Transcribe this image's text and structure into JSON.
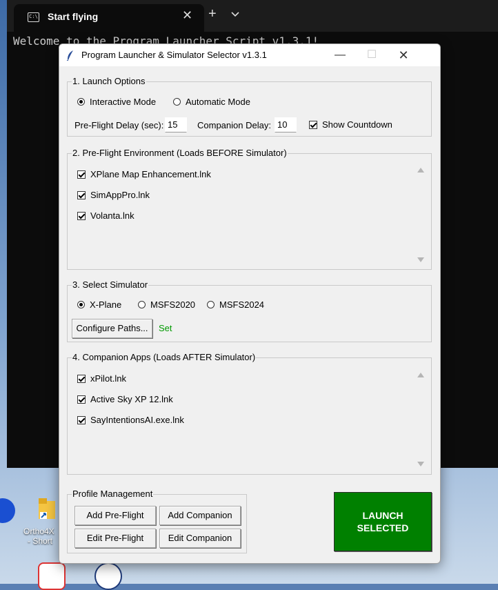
{
  "terminal": {
    "tab_title": "Start flying",
    "tab_close": "✕",
    "new_tab": "+",
    "dropdown": "⌄",
    "console_line": "Welcome to the Program Launcher Script v1.3.1!"
  },
  "desktop": {
    "icon_label_line1": "Ortho4X",
    "icon_label_line2": "- Short"
  },
  "dialog": {
    "title": "Program Launcher & Simulator Selector v1.3.1",
    "minimize": "—",
    "maximize": "☐",
    "close": "✕"
  },
  "launch_options": {
    "label": "1. Launch Options",
    "mode_interactive": "Interactive Mode",
    "mode_automatic": "Automatic Mode",
    "selected_mode": "interactive",
    "preflight_delay_label": "Pre-Flight Delay (sec):",
    "preflight_delay_value": "15",
    "companion_delay_label": "Companion Delay:",
    "companion_delay_value": "10",
    "show_countdown_label": "Show Countdown",
    "show_countdown_checked": true
  },
  "preflight": {
    "label": "2. Pre-Flight Environment (Loads BEFORE Simulator)",
    "items": [
      {
        "label": "XPlane Map Enhancement.lnk",
        "checked": true
      },
      {
        "label": "SimAppPro.lnk",
        "checked": true
      },
      {
        "label": "Volanta.lnk",
        "checked": true
      }
    ]
  },
  "simulator": {
    "label": "3. Select Simulator",
    "options": [
      "X-Plane",
      "MSFS2020",
      "MSFS2024"
    ],
    "selected": "X-Plane",
    "configure_label": "Configure Paths...",
    "status": "Set",
    "status_color": "#009900"
  },
  "companion": {
    "label": "4. Companion Apps (Loads AFTER Simulator)",
    "items": [
      {
        "label": "xPilot.lnk",
        "checked": true
      },
      {
        "label": "Active Sky XP 12.lnk",
        "checked": true
      },
      {
        "label": "SayIntentionsAI.exe.lnk",
        "checked": true
      }
    ]
  },
  "profile": {
    "label": "Profile Management",
    "add_preflight": "Add Pre-Flight",
    "add_companion": "Add Companion",
    "edit_preflight": "Edit Pre-Flight",
    "edit_companion": "Edit Companion"
  },
  "launch": {
    "line1": "LAUNCH",
    "line2": "SELECTED",
    "color": "#008000"
  }
}
